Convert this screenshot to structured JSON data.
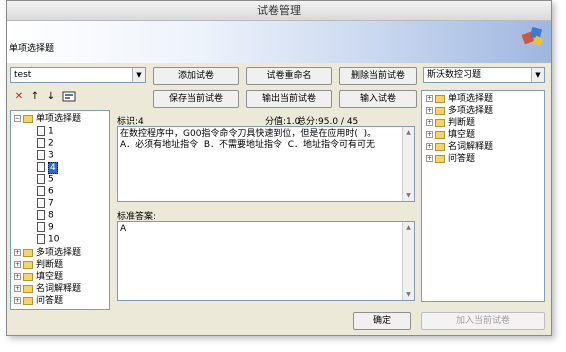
{
  "window": {
    "title": "试卷管理"
  },
  "banner": {
    "subtitle": "单项选择题"
  },
  "paper_select": {
    "value": "test"
  },
  "bank_select": {
    "value": "斯沃数控习题"
  },
  "toolbar": {
    "add_paper": "添加试卷",
    "rename_paper": "试卷重命名",
    "delete_paper": "删除当前试卷",
    "save_paper": "保存当前试卷",
    "export_paper": "输出当前试卷",
    "import_paper": "输入试卷"
  },
  "left_tree": {
    "root": "单项选择题",
    "children": [
      "1",
      "2",
      "3",
      "4",
      "5",
      "6",
      "7",
      "8",
      "9",
      "10"
    ],
    "selected_index": 3,
    "others": [
      "多项选择题",
      "判断题",
      "填空题",
      "名词解释题",
      "问答题"
    ]
  },
  "right_tree": {
    "items": [
      "单项选择题",
      "多项选择题",
      "判断题",
      "填空题",
      "名词解释题",
      "问答题"
    ]
  },
  "question": {
    "id_label": "标识:4",
    "score_label": "分值:1.0",
    "total_label": "总分:95.0 / 45",
    "text": "在数控程序中，G00指令命令刀具快速到位，但是在应用时(  )。\nA．必须有地址指令  B．不需要地址指令  C．地址指令可有可无"
  },
  "answer": {
    "label": "标准答案:",
    "text": "A"
  },
  "footer": {
    "ok": "确定",
    "add_current": "加入当前试卷"
  },
  "colors": {
    "selection": "#316ac5",
    "folder": "#f5d56a"
  }
}
